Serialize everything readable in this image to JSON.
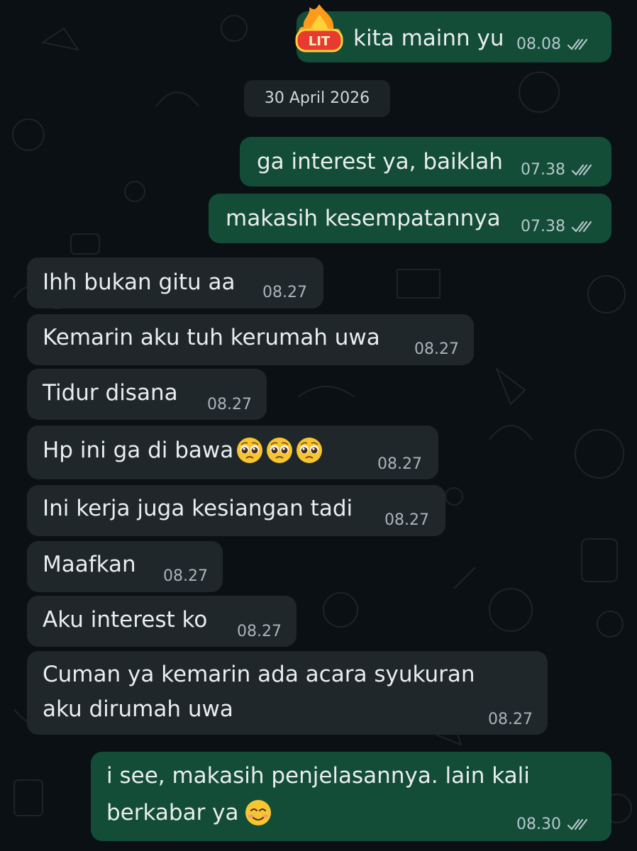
{
  "date_separator": "30 April 2026",
  "colors": {
    "outgoing_bubble": "#134d37",
    "incoming_bubble": "#1f272a",
    "read_ticks": "#b7c6cd",
    "background": "#0b1014"
  },
  "messages": [
    {
      "text": "kita mainn yu",
      "time": "08.08",
      "direction": "out",
      "sticker": "LIT"
    },
    {
      "text": "ga interest ya, baiklah",
      "time": "07.38",
      "direction": "out"
    },
    {
      "text": "makasih kesempatannya",
      "time": "07.38",
      "direction": "out"
    },
    {
      "text": "Ihh bukan gitu aa",
      "time": "08.27",
      "direction": "in"
    },
    {
      "text": "Kemarin aku tuh kerumah uwa",
      "time": "08.27",
      "direction": "in"
    },
    {
      "text": "Tidur disana",
      "time": "08.27",
      "direction": "in"
    },
    {
      "text": "Hp ini ga di bawa",
      "time": "08.27",
      "direction": "in",
      "emoji": "pleading-face-emoji x3"
    },
    {
      "text": "Ini kerja juga kesiangan tadi",
      "time": "08.27",
      "direction": "in"
    },
    {
      "text": "Maafkan",
      "time": "08.27",
      "direction": "in"
    },
    {
      "text": "Aku interest ko",
      "time": "08.27",
      "direction": "in"
    },
    {
      "text_line1": "Cuman ya kemarin ada acara syukuran",
      "text_line2": "aku dirumah uwa",
      "time": "08.27",
      "direction": "in"
    },
    {
      "text_line1": "i see, makasih penjelasannya. lain kali",
      "text_line2": "berkabar ya",
      "time": "08.30",
      "direction": "out",
      "emoji": "smiling-face-emoji"
    }
  ]
}
